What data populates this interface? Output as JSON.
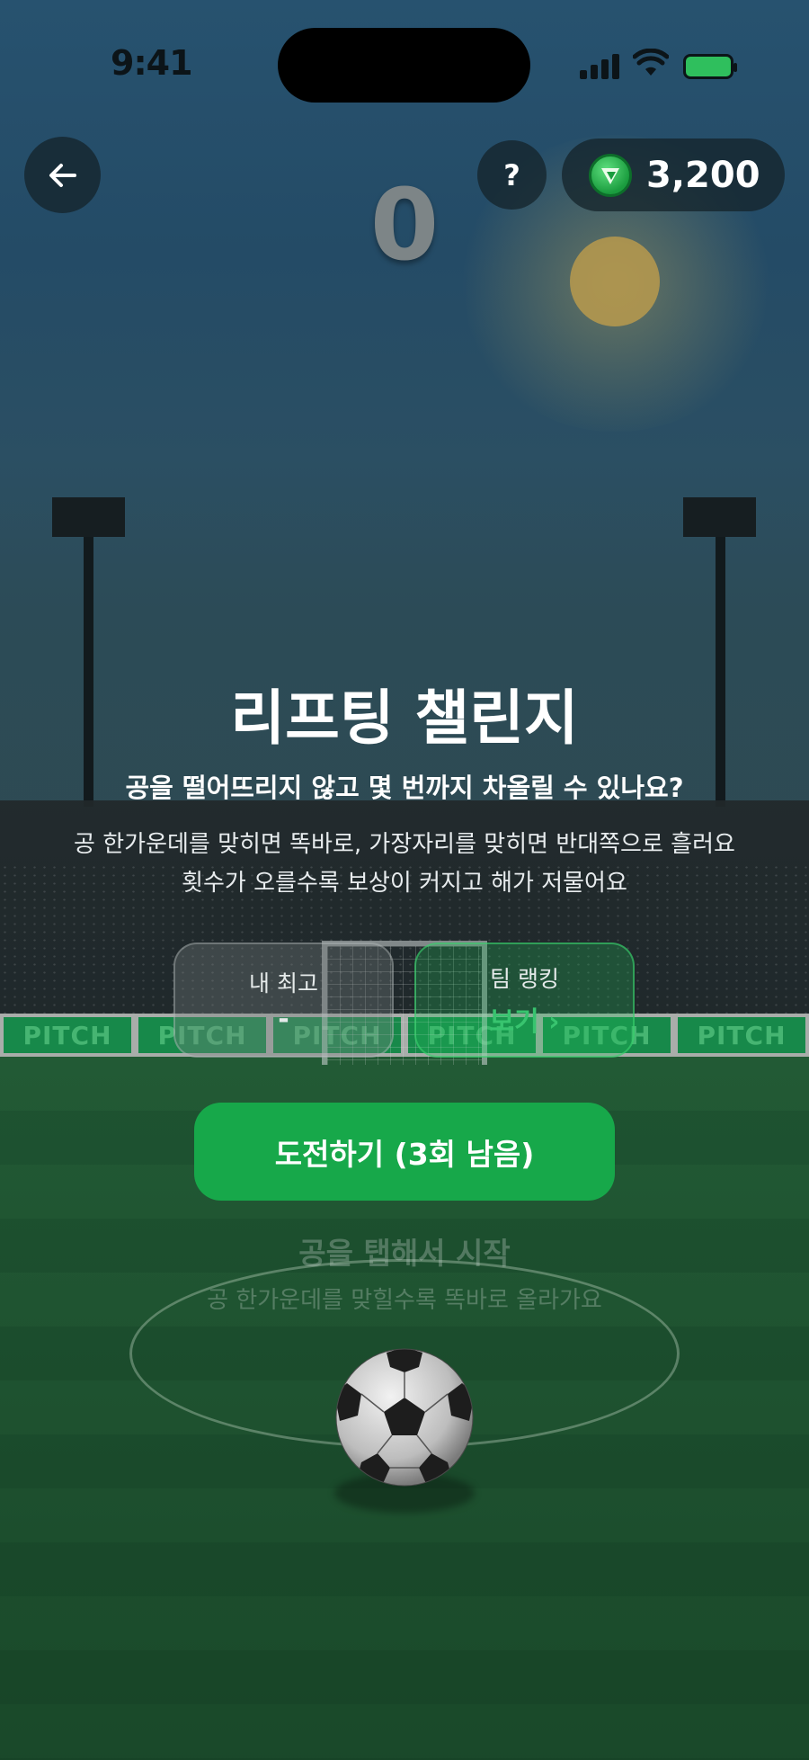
{
  "status_bar": {
    "time": "9:41"
  },
  "header": {
    "back_icon": "arrow-left-icon",
    "help_label": "?",
    "coin_icon": "coin-icon",
    "coin_balance": "3,200"
  },
  "game": {
    "score": "0"
  },
  "intro": {
    "title": "리프팅 챌린지",
    "subtitle": "공을 떨어뜨리지 않고 몇 번까지 차올릴 수 있나요?",
    "desc_line1": "공 한가운데를 맞히면 똑바로, 가장자리를 맞히면 반대쪽으로 흘러요",
    "desc_line2": "횟수가 오를수록 보상이 커지고 해가 저물어요"
  },
  "stats": {
    "best_label": "내 최고",
    "best_value": "-",
    "rank_label": "팀 랭킹",
    "rank_value": "보기 ›"
  },
  "boards": [
    "PITCH",
    "PITCH",
    "PITCH",
    "PITCH",
    "PITCH",
    "PITCH"
  ],
  "actions": {
    "start_label": "도전하기 (3회 남음)"
  },
  "hint": {
    "title": "공을 탭해서 시작",
    "subtitle": "공 한가운데를 맞힐수록 똑바로 올라가요"
  },
  "colors": {
    "accent": "#17a84a",
    "sky_top": "#27526f",
    "pitch": "#225a35"
  }
}
